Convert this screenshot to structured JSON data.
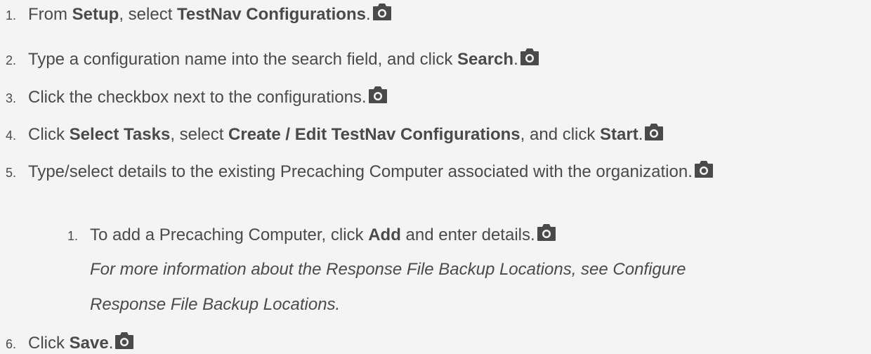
{
  "steps": [
    {
      "num": "1.",
      "segments": [
        {
          "text": "From ",
          "bold": false
        },
        {
          "text": "Setup",
          "bold": true
        },
        {
          "text": ", select ",
          "bold": false
        },
        {
          "text": "TestNav Configurations",
          "bold": true
        },
        {
          "text": ".",
          "bold": false
        }
      ],
      "icon": "camera-icon"
    },
    {
      "num": "2.",
      "segments": [
        {
          "text": "Type a configuration name into the search field, and click ",
          "bold": false
        },
        {
          "text": "Search",
          "bold": true
        },
        {
          "text": ".",
          "bold": false
        }
      ],
      "icon": "camera-icon"
    },
    {
      "num": "3.",
      "segments": [
        {
          "text": "Click the checkbox next to the configurations.",
          "bold": false
        }
      ],
      "icon": "camera-icon"
    },
    {
      "num": "4.",
      "segments": [
        {
          "text": "Click ",
          "bold": false
        },
        {
          "text": "Select Tasks",
          "bold": true
        },
        {
          "text": ", select ",
          "bold": false
        },
        {
          "text": "Create / Edit TestNav Configurations",
          "bold": true
        },
        {
          "text": ", and click ",
          "bold": false
        },
        {
          "text": "Start",
          "bold": true
        },
        {
          "text": ".",
          "bold": false
        }
      ],
      "icon": "camera-icon"
    },
    {
      "num": "5.",
      "segments": [
        {
          "text": "Type/select details to the existing Precaching Computer associated with the organization.",
          "bold": false
        }
      ],
      "icon": "camera-icon"
    },
    {
      "num": "1.",
      "segments": [
        {
          "text": "To add a Precaching Computer, click ",
          "bold": false
        },
        {
          "text": "Add",
          "bold": true
        },
        {
          "text": " and enter details.",
          "bold": false
        }
      ],
      "icon": "camera-icon"
    },
    {
      "num": "6.",
      "segments": [
        {
          "text": "Click ",
          "bold": false
        },
        {
          "text": "Save",
          "bold": true
        },
        {
          "text": ".",
          "bold": false
        }
      ],
      "icon": "camera-icon"
    }
  ],
  "note": {
    "line1": "For more information about the Response File Backup Locations, see Configure",
    "line2": "Response File Backup Locations."
  },
  "colors": {
    "background": "#f4f4f4",
    "text": "#4a4a4a",
    "icon": "#4a4a4a"
  }
}
